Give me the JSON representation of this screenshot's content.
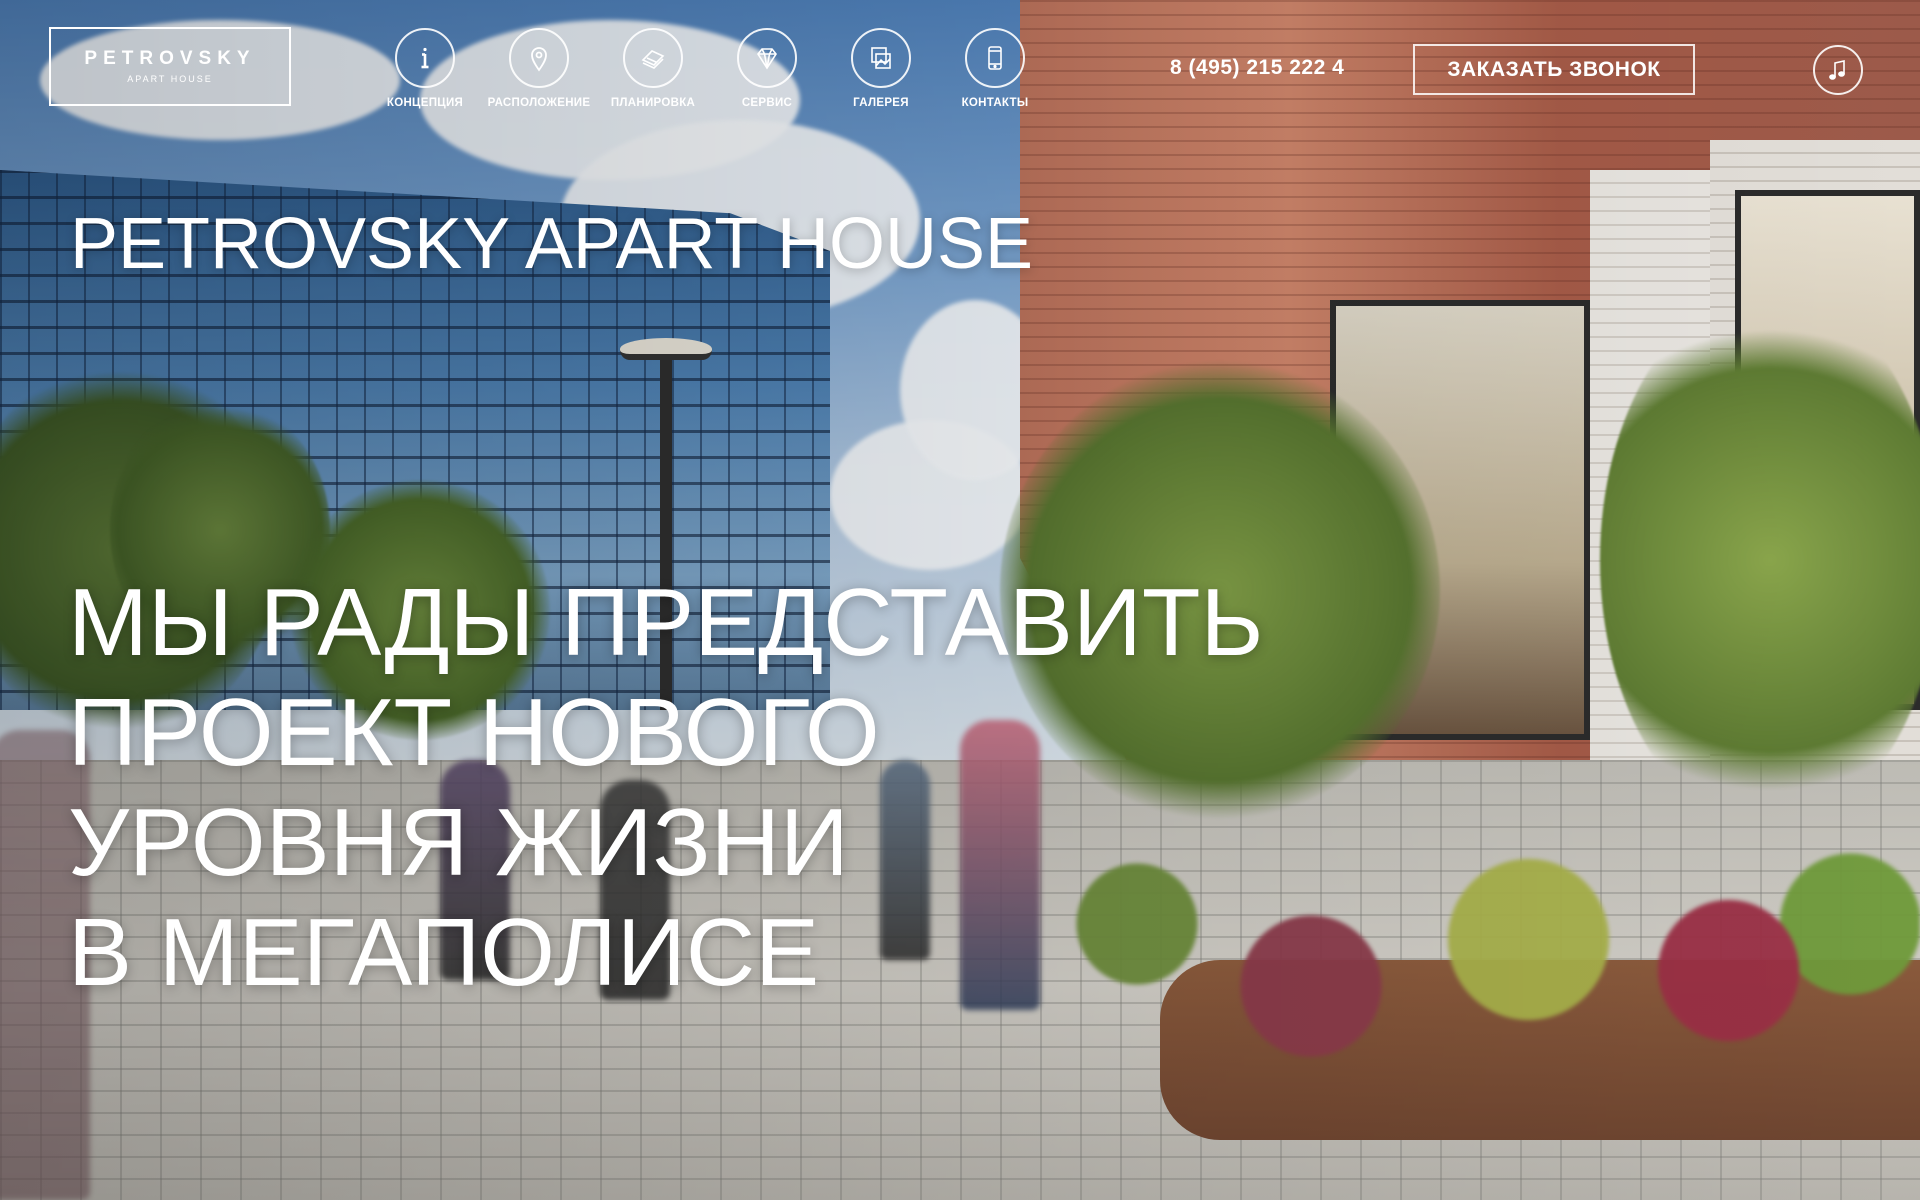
{
  "header": {
    "logo": {
      "title": "PETROVSKY",
      "subtitle": "APART HOUSE"
    },
    "nav": [
      {
        "label": "КОНЦЕПЦИЯ",
        "icon": "info-icon"
      },
      {
        "label": "РАСПОЛОЖЕНИЕ",
        "icon": "map-pin-icon"
      },
      {
        "label": "ПЛАНИРОВКА",
        "icon": "floor-plan-icon"
      },
      {
        "label": "СЕРВИС",
        "icon": "diamond-icon"
      },
      {
        "label": "ГАЛЕРЕЯ",
        "icon": "gallery-icon"
      },
      {
        "label": "КОНТАКТЫ",
        "icon": "phone-icon"
      }
    ],
    "phone": "8 (495) 215 222 4",
    "callback_label": "ЗАКАЗАТЬ ЗВОНОК",
    "music_icon": "music-note-icon"
  },
  "hero": {
    "title": "PETROVSKY APART HOUSE",
    "headline_lines": [
      "МЫ РАДЫ ПРЕДСТАВИТЬ",
      "ПРОЕКТ НОВОГО",
      "УРОВНЯ ЖИЗНИ",
      "В МЕГАПОЛИСЕ"
    ]
  },
  "colors": {
    "text": "#ffffff",
    "outline": "#ffffff"
  }
}
